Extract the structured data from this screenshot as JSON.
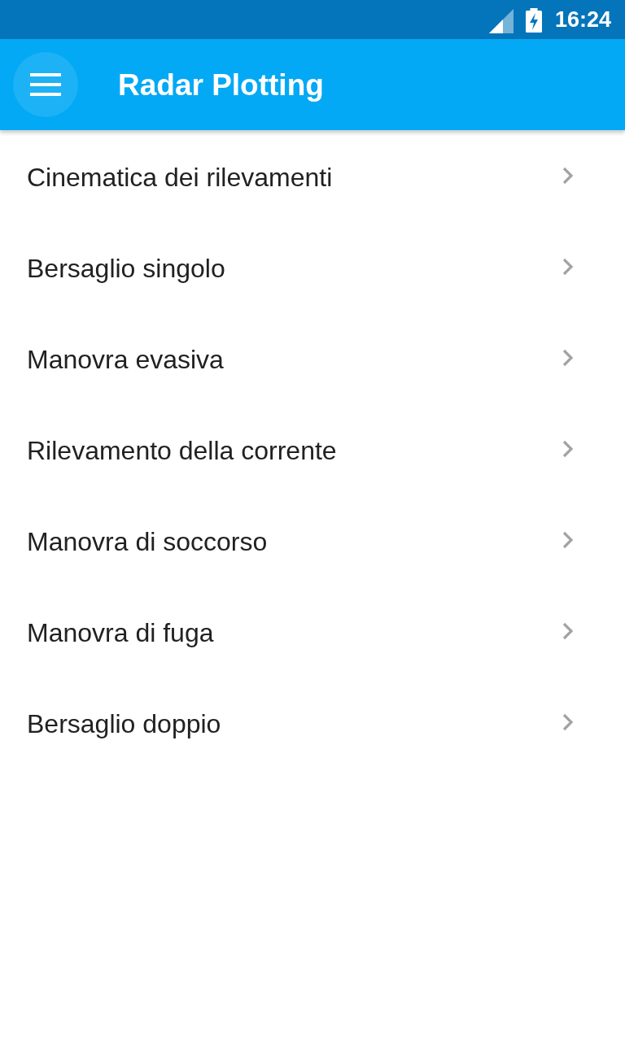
{
  "status_bar": {
    "time": "16:24",
    "charging": true
  },
  "app_bar": {
    "title": "Radar Plotting"
  },
  "menu_items": [
    {
      "label": "Cinematica dei rilevamenti"
    },
    {
      "label": "Bersaglio singolo"
    },
    {
      "label": "Manovra evasiva"
    },
    {
      "label": "Rilevamento della corrente"
    },
    {
      "label": "Manovra di soccorso"
    },
    {
      "label": "Manovra di fuga"
    },
    {
      "label": "Bersaglio doppio"
    }
  ]
}
